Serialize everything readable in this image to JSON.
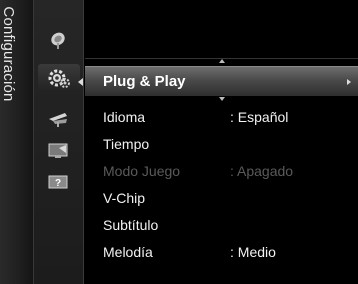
{
  "sidebar": {
    "title": "Configuración",
    "icons": [
      {
        "name": "satellite-dish-icon"
      },
      {
        "name": "gear-icon",
        "active": true
      },
      {
        "name": "antenna-icon"
      },
      {
        "name": "monitor-input-icon"
      },
      {
        "name": "help-icon",
        "glyph": "?"
      }
    ]
  },
  "menu": {
    "selected": "Plug & Play",
    "items": [
      {
        "label": "Idioma",
        "value": ": Español",
        "enabled": true
      },
      {
        "label": "Tiempo",
        "value": "",
        "enabled": true
      },
      {
        "label": "Modo Juego",
        "value": ": Apagado",
        "enabled": false
      },
      {
        "label": "V-Chip",
        "value": "",
        "enabled": true
      },
      {
        "label": "Subtítulo",
        "value": "",
        "enabled": true
      },
      {
        "label": "Melodía",
        "value": ": Medio",
        "enabled": true
      }
    ]
  },
  "colors": {
    "background": "#000000",
    "highlight": "#5a5a5a",
    "disabled_text": "#5a5a5a"
  }
}
